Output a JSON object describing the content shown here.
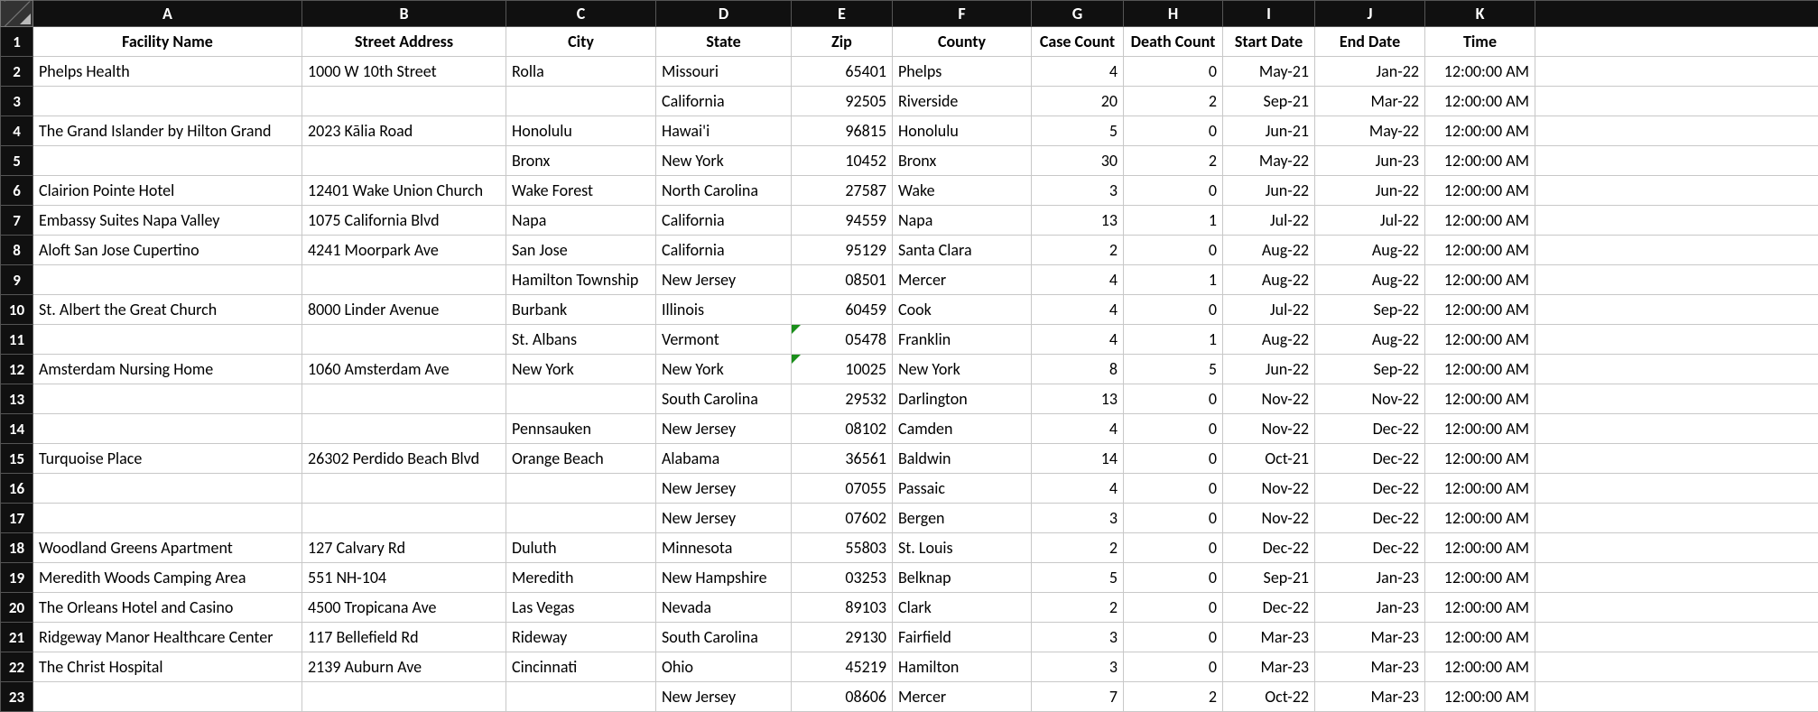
{
  "columns": [
    "A",
    "B",
    "C",
    "D",
    "E",
    "F",
    "G",
    "H",
    "I",
    "J",
    "K"
  ],
  "headerRow": {
    "A": "Facility Name",
    "B": "Street Address",
    "C": "City",
    "D": "State",
    "E": "Zip",
    "F": "County",
    "G": "Case Count",
    "H": "Death Count",
    "I": "Start Date",
    "J": "End Date",
    "K": "Time"
  },
  "chart_data": {
    "type": "table",
    "columns": [
      "Facility Name",
      "Street Address",
      "City",
      "State",
      "Zip",
      "County",
      "Case Count",
      "Death Count",
      "Start Date",
      "End Date",
      "Time"
    ],
    "rows": [
      {
        "A": "Phelps Health",
        "B": "1000 W 10th Street",
        "C": "Rolla",
        "D": "Missouri",
        "E": "65401",
        "F": "Phelps",
        "G": "4",
        "H": "0",
        "I": "May-21",
        "J": "Jan-22",
        "K": "12:00:00 AM"
      },
      {
        "A": "",
        "B": "",
        "C": "",
        "D": "California",
        "E": "92505",
        "F": "Riverside",
        "G": "20",
        "H": "2",
        "I": "Sep-21",
        "J": "Mar-22",
        "K": "12:00:00 AM"
      },
      {
        "A": "The Grand Islander by Hilton Grand",
        "B": "2023 Kālia Road",
        "C": "Honolulu",
        "D": "Hawai'i",
        "E": "96815",
        "F": "Honolulu",
        "G": "5",
        "H": "0",
        "I": "Jun-21",
        "J": "May-22",
        "K": "12:00:00 AM"
      },
      {
        "A": "",
        "B": "",
        "C": "Bronx",
        "D": "New York",
        "E": "10452",
        "F": "Bronx",
        "G": "30",
        "H": "2",
        "I": "May-22",
        "J": "Jun-23",
        "K": "12:00:00 AM"
      },
      {
        "A": "Clairion Pointe Hotel",
        "B": "12401 Wake Union Church",
        "C": "Wake Forest",
        "D": "North Carolina",
        "E": "27587",
        "F": "Wake",
        "G": "3",
        "H": "0",
        "I": "Jun-22",
        "J": "Jun-22",
        "K": "12:00:00 AM"
      },
      {
        "A": "Embassy Suites Napa Valley",
        "B": "1075 California Blvd",
        "C": "Napa",
        "D": "California",
        "E": "94559",
        "F": "Napa",
        "G": "13",
        "H": "1",
        "I": "Jul-22",
        "J": "Jul-22",
        "K": "12:00:00 AM"
      },
      {
        "A": "Aloft San Jose Cupertino",
        "B": "4241 Moorpark Ave",
        "C": "San Jose",
        "D": "California",
        "E": "95129",
        "F": "Santa Clara",
        "G": "2",
        "H": "0",
        "I": "Aug-22",
        "J": "Aug-22",
        "K": "12:00:00 AM"
      },
      {
        "A": "",
        "B": "",
        "C": "Hamilton Township",
        "D": "New Jersey",
        "E": "08501",
        "F": "Mercer",
        "G": "4",
        "H": "1",
        "I": "Aug-22",
        "J": "Aug-22",
        "K": "12:00:00 AM"
      },
      {
        "A": "St. Albert the Great Church",
        "B": "8000 Linder Avenue",
        "C": "Burbank",
        "D": "Illinois",
        "E": "60459",
        "F": "Cook",
        "G": "4",
        "H": "0",
        "I": "Jul-22",
        "J": "Sep-22",
        "K": "12:00:00 AM"
      },
      {
        "A": "",
        "B": "",
        "C": "St. Albans",
        "D": "Vermont",
        "E": "05478",
        "F": "Franklin",
        "G": "4",
        "H": "1",
        "I": "Aug-22",
        "J": "Aug-22",
        "K": "12:00:00 AM",
        "err": true
      },
      {
        "A": "Amsterdam Nursing Home",
        "B": "1060 Amsterdam Ave",
        "C": "New York",
        "D": "New York",
        "E": "10025",
        "F": "New York",
        "G": "8",
        "H": "5",
        "I": "Jun-22",
        "J": "Sep-22",
        "K": "12:00:00 AM",
        "err": true
      },
      {
        "A": "",
        "B": "",
        "C": "",
        "D": "South Carolina",
        "E": "29532",
        "F": "Darlington",
        "G": "13",
        "H": "0",
        "I": "Nov-22",
        "J": "Nov-22",
        "K": "12:00:00 AM"
      },
      {
        "A": "",
        "B": "",
        "C": "Pennsauken",
        "D": "New Jersey",
        "E": "08102",
        "F": "Camden",
        "G": "4",
        "H": "0",
        "I": "Nov-22",
        "J": "Dec-22",
        "K": "12:00:00 AM"
      },
      {
        "A": "Turquoise Place",
        "B": "26302 Perdido Beach Blvd",
        "C": "Orange Beach",
        "D": "Alabama",
        "E": "36561",
        "F": "Baldwin",
        "G": "14",
        "H": "0",
        "I": "Oct-21",
        "J": "Dec-22",
        "K": "12:00:00 AM"
      },
      {
        "A": "",
        "B": "",
        "C": "",
        "D": "New Jersey",
        "E": "07055",
        "F": "Passaic",
        "G": "4",
        "H": "0",
        "I": "Nov-22",
        "J": "Dec-22",
        "K": "12:00:00 AM"
      },
      {
        "A": "",
        "B": "",
        "C": "",
        "D": "New Jersey",
        "E": "07602",
        "F": "Bergen",
        "G": "3",
        "H": "0",
        "I": "Nov-22",
        "J": "Dec-22",
        "K": "12:00:00 AM"
      },
      {
        "A": "Woodland Greens Apartment",
        "B": "127 Calvary Rd",
        "C": "Duluth",
        "D": "Minnesota",
        "E": "55803",
        "F": "St. Louis",
        "G": "2",
        "H": "0",
        "I": "Dec-22",
        "J": "Dec-22",
        "K": "12:00:00 AM"
      },
      {
        "A": "Meredith Woods Camping Area",
        "B": "551 NH-104",
        "C": "Meredith",
        "D": "New Hampshire",
        "E": "03253",
        "F": "Belknap",
        "G": "5",
        "H": "0",
        "I": "Sep-21",
        "J": "Jan-23",
        "K": "12:00:00 AM"
      },
      {
        "A": "The Orleans Hotel and Casino",
        "B": "4500 Tropicana Ave",
        "C": "Las Vegas",
        "D": "Nevada",
        "E": "89103",
        "F": "Clark",
        "G": "2",
        "H": "0",
        "I": "Dec-22",
        "J": "Jan-23",
        "K": "12:00:00 AM"
      },
      {
        "A": "Ridgeway Manor Healthcare Center",
        "B": "117 Bellefield Rd",
        "C": "Rideway",
        "D": "South Carolina",
        "E": "29130",
        "F": "Fairfield",
        "G": "3",
        "H": "0",
        "I": "Mar-23",
        "J": "Mar-23",
        "K": "12:00:00 AM"
      },
      {
        "A": "The Christ Hospital",
        "B": "2139 Auburn Ave",
        "C": "Cincinnati",
        "D": "Ohio",
        "E": "45219",
        "F": "Hamilton",
        "G": "3",
        "H": "0",
        "I": "Mar-23",
        "J": "Mar-23",
        "K": "12:00:00 AM"
      },
      {
        "A": "",
        "B": "",
        "C": "",
        "D": "New Jersey",
        "E": "08606",
        "F": "Mercer",
        "G": "7",
        "H": "2",
        "I": "Oct-22",
        "J": "Mar-23",
        "K": "12:00:00 AM"
      }
    ]
  },
  "numericCols": [
    "E",
    "G",
    "H",
    "I",
    "J",
    "K"
  ]
}
